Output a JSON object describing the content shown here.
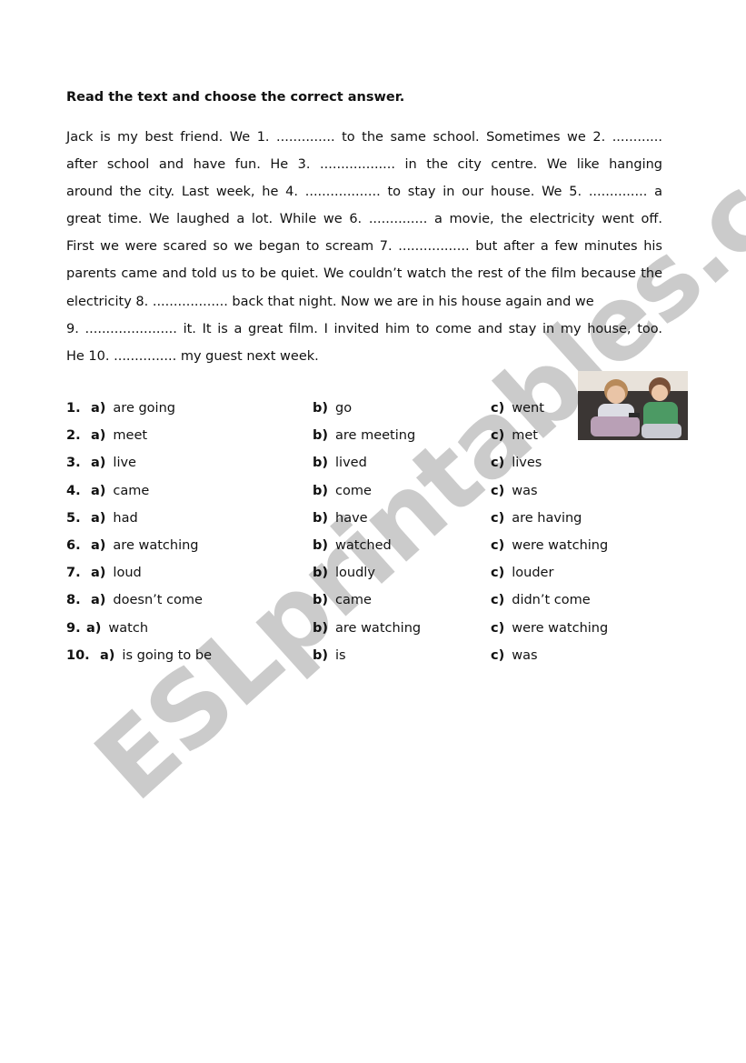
{
  "worksheet": {
    "instruction": "Read the text and choose the correct answer.",
    "paragraph_lines": [
      "Jack is my best friend. We 1.  .............. to the same school. Sometimes we 2. ............",
      "after school and have fun.  He 3.  .................. in the city centre. We like hanging",
      "around the city. Last week, he 4. .................. to stay in our house. We 5. .............. a",
      "great time. We laughed a lot. While we 6.  .............. a movie, the electricity went off.",
      "First we were scared so we began to scream 7. ................. but after a few minutes his",
      "parents came and told us to be quiet. We couldn’t watch the rest of the film because the",
      "electricity 8. .................. back that night.  Now we are in his house again and we",
      "9. ...................... it. It is a great film. I invited him to come and stay in my house, too.",
      "He 10. ............... my guest next week."
    ],
    "questions": [
      {
        "num": "1.",
        "a": "are going",
        "b": "go",
        "c": "went"
      },
      {
        "num": "2.",
        "a": "meet",
        "b": "are meeting",
        "c": "met"
      },
      {
        "num": "3.",
        "a": "live",
        "b": "lived",
        "c": "lives"
      },
      {
        "num": "4.",
        "a": "came",
        "b": "come",
        "c": "was"
      },
      {
        "num": "5.",
        "a": "had",
        "b": "have",
        "c": "are having"
      },
      {
        "num": "6.",
        "a": "are watching",
        "b": "watched",
        "c": "were watching"
      },
      {
        "num": "7.",
        "a": "loud",
        "b": "loudly",
        "c": "louder"
      },
      {
        "num": "8.",
        "a": "doesn’t come",
        "b": "came",
        "c": "didn’t come"
      },
      {
        "num": "9.",
        "a": "watch",
        "b": "are watching",
        "c": "were watching"
      },
      {
        "num": "10.",
        "a": "is going to be",
        "b": "is",
        "c": "was"
      }
    ],
    "option_labels": {
      "a": "a)",
      "b": "b)",
      "c": "c)"
    },
    "photo_icon": "two-boys-watching-tv-photo",
    "watermark_text": "ESLprintables.com",
    "watermark_color": "#c8c8c8"
  }
}
